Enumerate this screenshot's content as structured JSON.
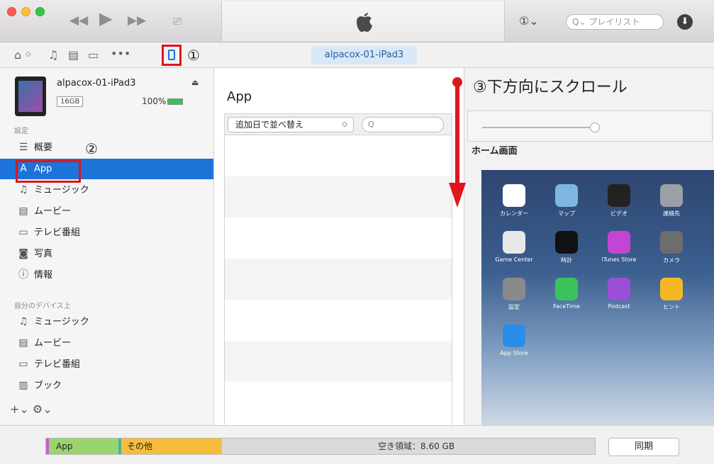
{
  "titlebar": {
    "search_placeholder": "Q⌄ プレイリスト",
    "account_glyph": "①⌄",
    "download_glyph": "⬇"
  },
  "toolbar": {
    "marker1": "①",
    "device_name": "alpacox-01-iPad3"
  },
  "device": {
    "name": "alpacox-01-iPad3",
    "capacity": "16GB",
    "battery": "100%"
  },
  "sidebar": {
    "settings_label": "設定",
    "marker2": "②",
    "settings_items": [
      {
        "label": "概要",
        "icon": "summary-icon",
        "glyph": "☰"
      },
      {
        "label": "App",
        "icon": "app-store-icon",
        "glyph": "A"
      },
      {
        "label": "ミュージック",
        "icon": "music-icon",
        "glyph": "♫"
      },
      {
        "label": "ムービー",
        "icon": "film-icon",
        "glyph": "▤"
      },
      {
        "label": "テレビ番組",
        "icon": "tv-icon",
        "glyph": "▭"
      },
      {
        "label": "写真",
        "icon": "camera-icon",
        "glyph": "◙"
      },
      {
        "label": "情報",
        "icon": "info-icon",
        "glyph": "ⓘ"
      }
    ],
    "ondevice_label": "自分のデバイス上",
    "ondevice_items": [
      {
        "label": "ミュージック",
        "icon": "music-icon",
        "glyph": "♫"
      },
      {
        "label": "ムービー",
        "icon": "film-icon",
        "glyph": "▤"
      },
      {
        "label": "テレビ番組",
        "icon": "tv-icon",
        "glyph": "▭"
      },
      {
        "label": "ブック",
        "icon": "book-icon",
        "glyph": "▥"
      }
    ],
    "footer": "+⌄  ⚙⌄"
  },
  "middle": {
    "title": "App",
    "sort_label": "追加日で並べ替え",
    "search_glyph": "Q"
  },
  "right": {
    "home_label": "ホーム画面",
    "apps": [
      {
        "name": "カレンダー",
        "color": "#ffffff"
      },
      {
        "name": "マップ",
        "color": "#7fb6e0"
      },
      {
        "name": "ビデオ",
        "color": "#222222"
      },
      {
        "name": "連絡先",
        "color": "#9aa0a6"
      },
      {
        "name": "Game Center",
        "color": "#e8e8e8"
      },
      {
        "name": "時計",
        "color": "#111111"
      },
      {
        "name": "iTunes Store",
        "color": "#c346d3"
      },
      {
        "name": "カメラ",
        "color": "#6d6d6d"
      },
      {
        "name": "設定",
        "color": "#8a8a8a"
      },
      {
        "name": "FaceTime",
        "color": "#3ac35a"
      },
      {
        "name": "Podcast",
        "color": "#9b4fd6"
      },
      {
        "name": "ヒント",
        "color": "#f5b824"
      },
      {
        "name": "App Store",
        "color": "#2a8de8"
      }
    ]
  },
  "annotation": {
    "text": "③下方向にスクロール"
  },
  "bottom": {
    "app_label": "App",
    "other_label": "その他",
    "free_label": "空き領域：8.60 GB",
    "sync_label": "同期"
  },
  "colors": {
    "accent": "#1d73d8",
    "annotation_red": "#e0141b"
  }
}
